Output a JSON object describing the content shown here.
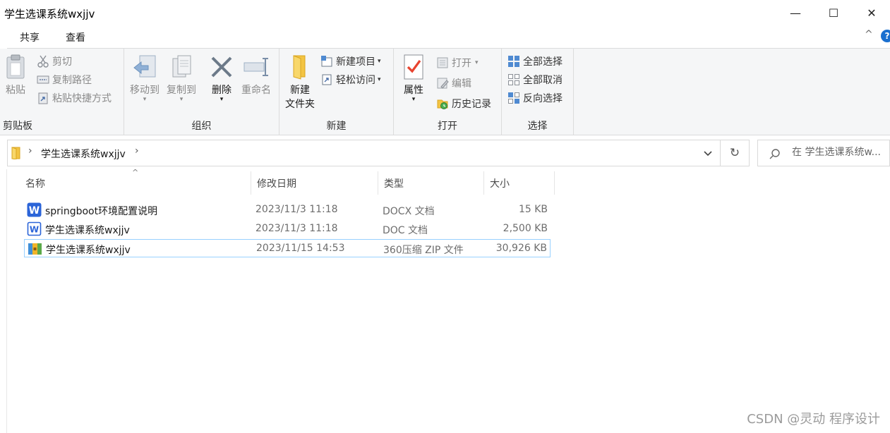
{
  "window": {
    "title": "学生选课系统wxjjv",
    "minimize_glyph": "—",
    "maximize_glyph": "☐",
    "close_glyph": "✕"
  },
  "tabs": {
    "share": "共享",
    "view": "查看"
  },
  "ribbon": {
    "clipboard": {
      "label": "剪贴板",
      "paste": "粘贴",
      "cut": "剪切",
      "copy_path": "复制路径",
      "paste_shortcut": "粘贴快捷方式"
    },
    "organize": {
      "label": "组织",
      "move_to": "移动到",
      "copy_to": "复制到",
      "delete": "删除",
      "rename": "重命名"
    },
    "new": {
      "label": "新建",
      "new_folder_line1": "新建",
      "new_folder_line2": "文件夹",
      "new_item": "新建项目",
      "easy_access": "轻松访问"
    },
    "open": {
      "label": "打开",
      "properties": "属性",
      "open": "打开",
      "edit": "编辑",
      "history": "历史记录"
    },
    "select": {
      "label": "选择",
      "select_all": "全部选择",
      "select_none": "全部取消",
      "invert": "反向选择"
    }
  },
  "address": {
    "path": "学生选课系统wxjjv",
    "search_placeholder": "在 学生选课系统w..."
  },
  "columns": {
    "name": "名称",
    "date": "修改日期",
    "type": "类型",
    "size": "大小"
  },
  "files": [
    {
      "name": "springboot环境配置说明",
      "date": "2023/11/3 11:18",
      "type": "DOCX 文档",
      "size": "15 KB",
      "icon": "wps-doc-icon"
    },
    {
      "name": "学生选课系统wxjjv",
      "date": "2023/11/3 11:18",
      "type": "DOC 文档",
      "size": "2,500 KB",
      "icon": "word-doc-icon"
    },
    {
      "name": "学生选课系统wxjjv",
      "date": "2023/11/15 14:53",
      "type": "360压缩 ZIP 文件",
      "size": "30,926 KB",
      "icon": "zip-archive-icon"
    }
  ],
  "watermark": "CSDN @灵动 程序设计",
  "colors": {
    "accent": "#1a6fcf",
    "selection_border": "#99d1ff",
    "ribbon_bg": "#f5f6f7"
  }
}
